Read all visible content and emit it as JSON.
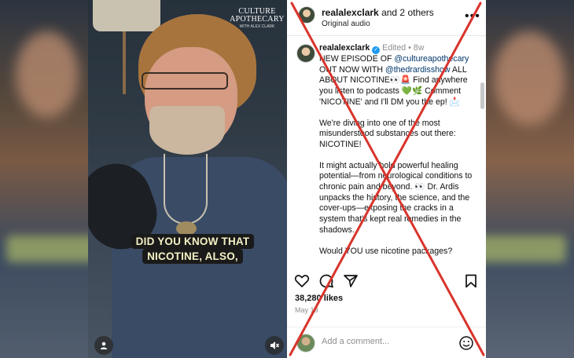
{
  "video": {
    "brand_line1": "CULTURE",
    "brand_line2": "APOTHECARY",
    "brand_sub": "WITH ALEX CLARK",
    "caption_line1": "DID YOU KNOW THAT",
    "caption_line2": "NICOTINE, ALSO,",
    "user_icon": "person-icon",
    "mute_icon": "muted-speaker-icon"
  },
  "header": {
    "username": "realalexclark",
    "others": "and 2 others",
    "audio": "Original audio",
    "more_icon": "more-dots-icon"
  },
  "post": {
    "username": "realalexclark",
    "edited": "Edited",
    "separator": "•",
    "age": "8w",
    "p1_a": "NEW EPISODE OF ",
    "mention1": "@cultureapothecary",
    "p1_b": " OUT NOW WITH ",
    "mention2": "@thedrardisshow",
    "p1_c": " ALL ABOUT NICOTINE👀🚨 Find anywhere you listen to podcasts 💚🌿 Comment 'NICOTINE' and I'll DM you the ep! 📩",
    "p2": "We're diving into one of the most misunderstood substances out there: NICOTINE!",
    "p3": "It might actually hold powerful healing potential—from neurological conditions to chronic pain and beyond. 👀 Dr. Ardis unpacks the history, the science, and the cover-ups—exposing the cracks in a system that's kept real remedies in the shadows.",
    "p4": "Would YOU use nicotine packages?"
  },
  "actions": {
    "like_icon": "heart-icon",
    "comment_icon": "comment-bubble-icon",
    "share_icon": "paper-plane-icon",
    "save_icon": "bookmark-icon"
  },
  "stats": {
    "likes": "38,280 likes",
    "date": "May 19"
  },
  "comment": {
    "placeholder": "Add a comment...",
    "emoji_icon": "smiley-icon"
  },
  "overlay": {
    "mark": "red-x-cross",
    "color": "#d9332b"
  }
}
